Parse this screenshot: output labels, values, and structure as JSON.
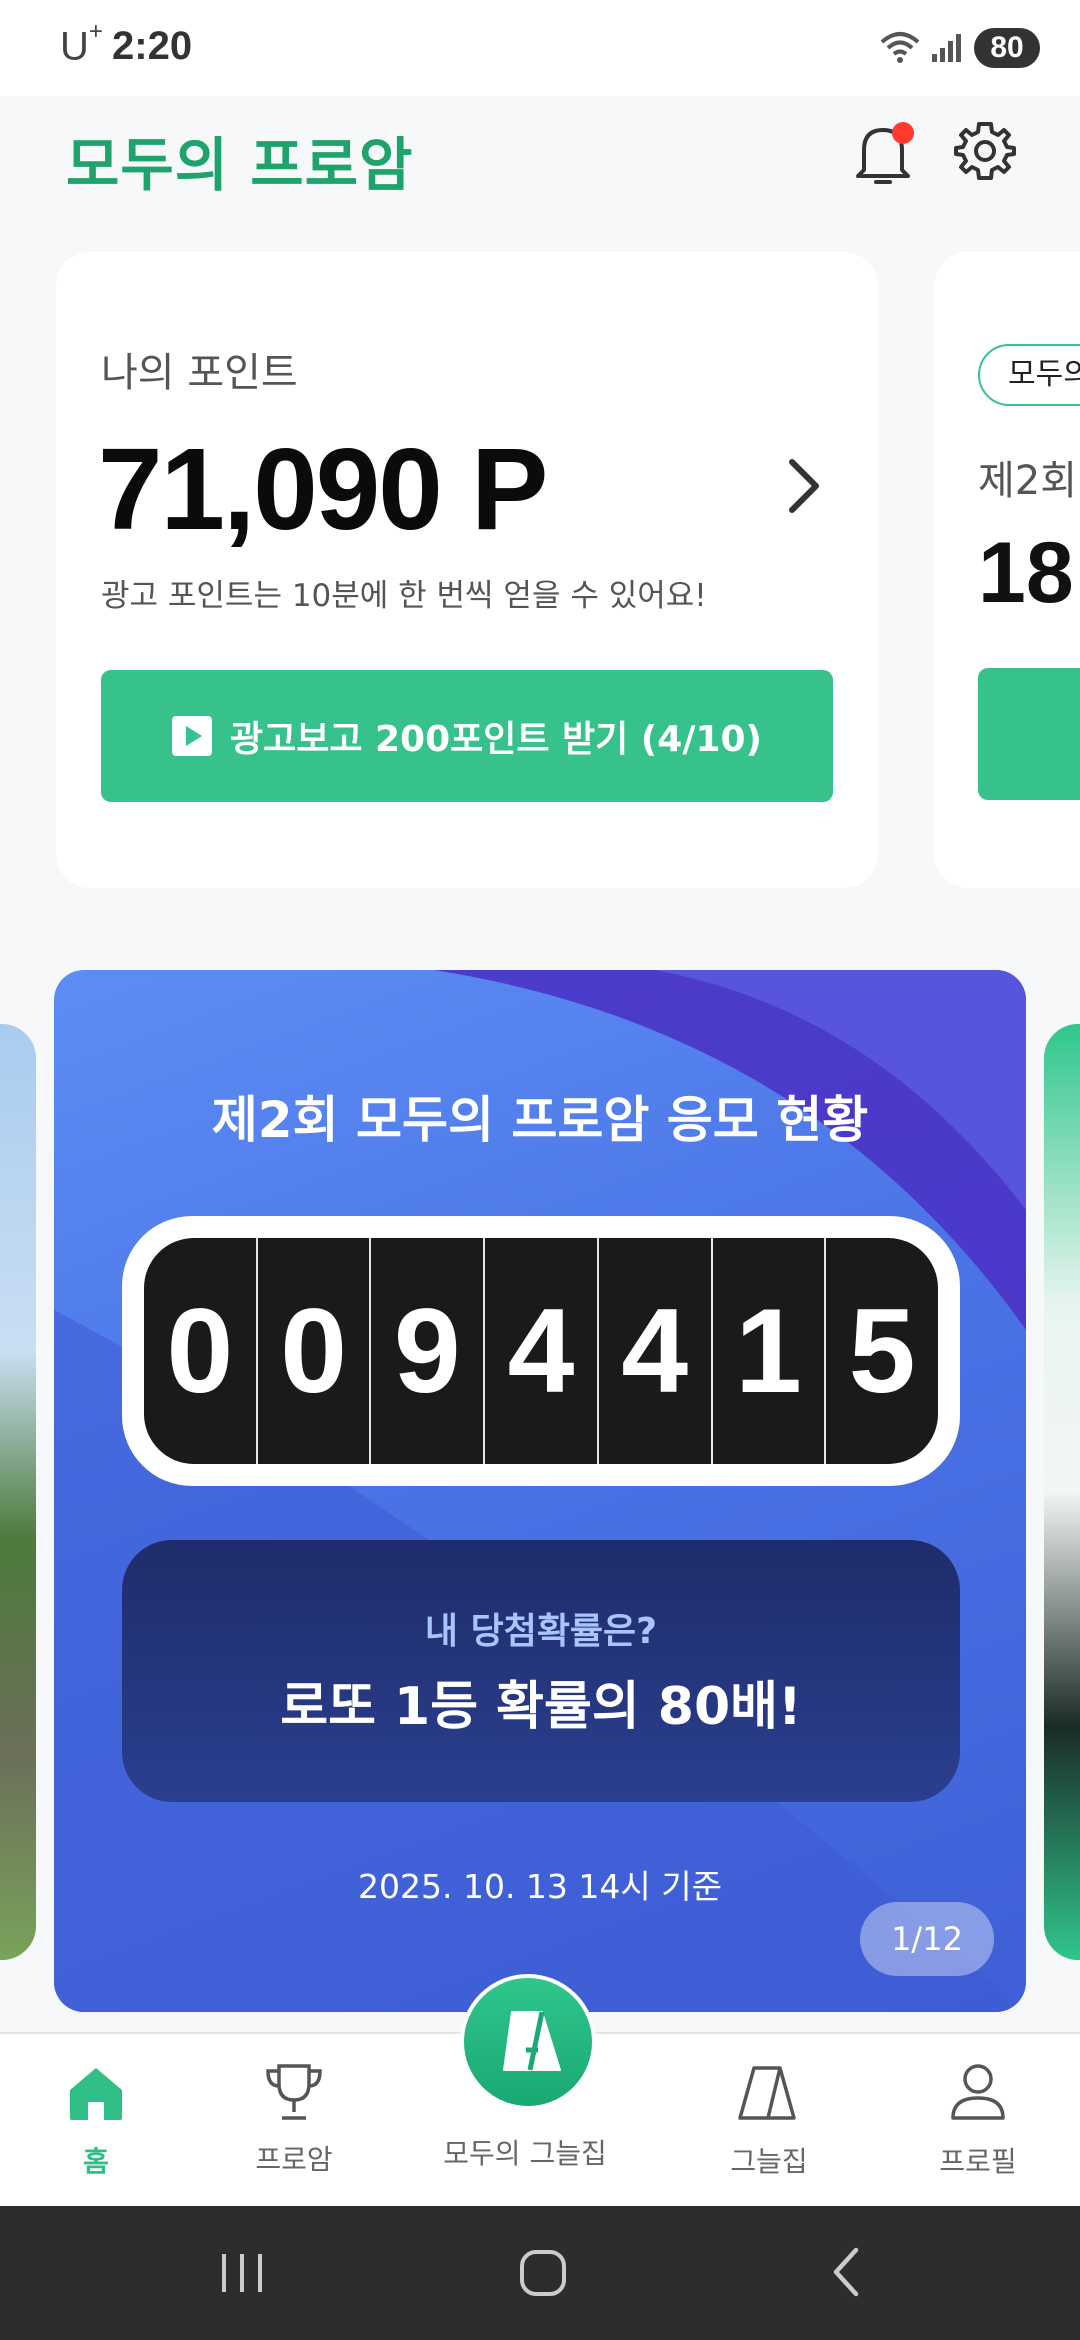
{
  "status_bar": {
    "carrier": "U",
    "carrier_sup": "+",
    "time": "2:20",
    "battery": "80"
  },
  "header": {
    "logo": "모두의 프로암"
  },
  "points_card": {
    "title": "나의 포인트",
    "value": "71,090 P",
    "description": "광고 포인트는 10분에 한 번씩 얻을 수 있어요!",
    "ad_button_label": "광고보고 200포인트 받기 (4/10)"
  },
  "peek_card": {
    "chip": "모두의",
    "title": "제2회",
    "value": "18"
  },
  "banner": {
    "title": "제2회 모두의 프로암 응모 현황",
    "counter_digits": [
      "0",
      "0",
      "9",
      "4",
      "4",
      "1",
      "5"
    ],
    "odds_question": "내 당첨확률은?",
    "odds_answer": "로또 1등 확률의 80배!",
    "date": "2025. 10. 13 14시 기준",
    "page_indicator": "1/12"
  },
  "bottom_nav": {
    "items": [
      {
        "label": "홈",
        "icon": "home-icon",
        "active": true
      },
      {
        "label": "프로암",
        "icon": "trophy-icon",
        "active": false
      },
      {
        "label": "모두의 그늘집",
        "icon": "shade-a-icon",
        "active": false
      },
      {
        "label": "그늘집",
        "icon": "shade-tent-icon",
        "active": false
      },
      {
        "label": "프로필",
        "icon": "profile-icon",
        "active": false
      }
    ]
  },
  "colors": {
    "brand_green": "#36c28a",
    "banner_blue": "#4a73e6",
    "notification_red": "#ff3b30"
  }
}
